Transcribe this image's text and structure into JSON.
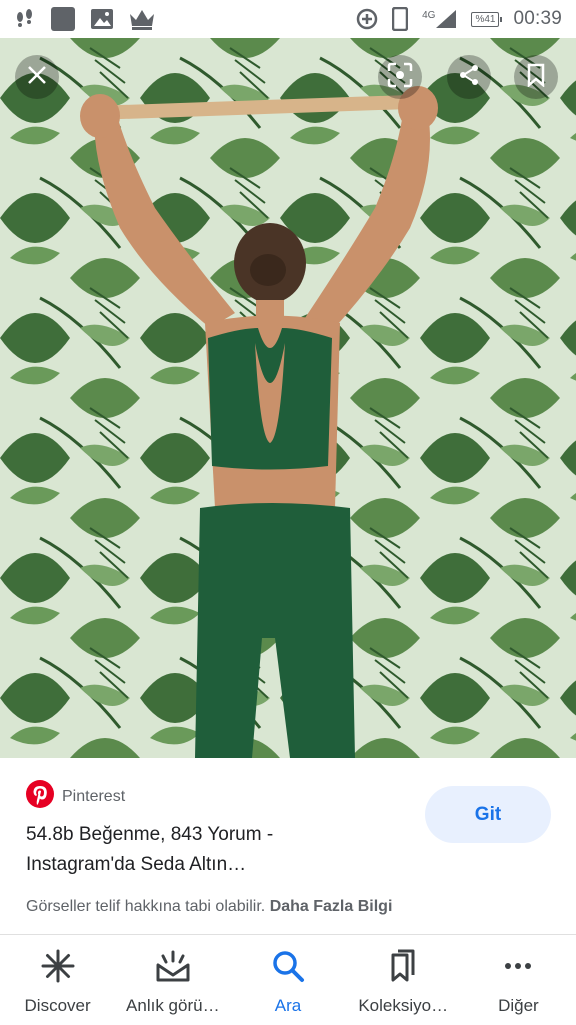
{
  "status_bar": {
    "time": "00:39",
    "network": "4G",
    "battery": "%41"
  },
  "image": {
    "description_icon_close": "close-icon",
    "lens": "lens-icon",
    "share": "share-icon",
    "save": "bookmark-icon"
  },
  "info": {
    "source": "Pinterest",
    "title_line1": "54.8b Beğenme, 843 Yorum -",
    "title_line2": "Instagram'da Seda Altın…",
    "visit_label": "Git",
    "copyright_text": "Görseller telif hakkına tabi olabilir.",
    "more_info": "Daha Fazla Bilgi"
  },
  "bottom_nav": {
    "items": [
      {
        "label": "Discover",
        "icon": "asterisk-icon"
      },
      {
        "label": "Anlık görü…",
        "icon": "updates-icon"
      },
      {
        "label": "Ara",
        "icon": "search-icon"
      },
      {
        "label": "Koleksiyo…",
        "icon": "collections-icon"
      },
      {
        "label": "Diğer",
        "icon": "more-icon"
      }
    ],
    "active_index": 2
  },
  "colors": {
    "accent": "#1a73e8",
    "button_bg": "#e8f0fe",
    "pinterest_red": "#e60023",
    "outfit_green": "#1f5e3a"
  }
}
